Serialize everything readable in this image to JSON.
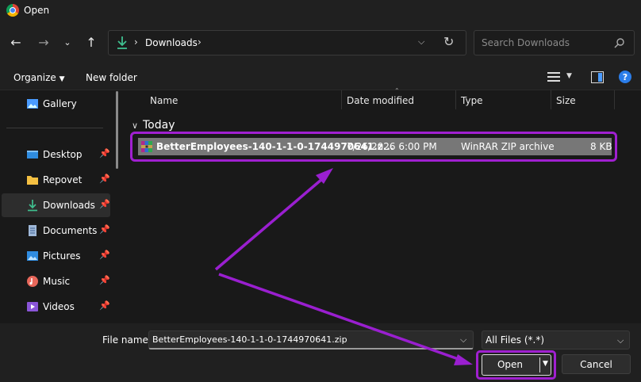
{
  "window": {
    "title": "Open"
  },
  "nav": {
    "breadcrumb_root": "Downloads",
    "search_placeholder": "Search Downloads"
  },
  "toolbar": {
    "organize_label": "Organize",
    "new_folder_label": "New folder"
  },
  "sidebar": {
    "items": [
      {
        "label": "Gallery",
        "icon": "gallery-icon"
      },
      {
        "label": "Desktop",
        "icon": "desktop-icon",
        "pinned": true
      },
      {
        "label": "Repovet",
        "icon": "folder-icon",
        "pinned": true
      },
      {
        "label": "Downloads",
        "icon": "download-icon",
        "pinned": true,
        "selected": true
      },
      {
        "label": "Documents",
        "icon": "documents-icon",
        "pinned": true
      },
      {
        "label": "Pictures",
        "icon": "pictures-icon",
        "pinned": true
      },
      {
        "label": "Music",
        "icon": "music-icon",
        "pinned": true
      },
      {
        "label": "Videos",
        "icon": "videos-icon",
        "pinned": true
      }
    ]
  },
  "columns": {
    "name": "Name",
    "date": "Date modified",
    "type": "Type",
    "size": "Size"
  },
  "group": {
    "label": "Today"
  },
  "files": [
    {
      "name": "BetterEmployees-140-1-1-0-1744970641.z...",
      "date": "7/26/2026 6:00 PM",
      "type": "WinRAR ZIP archive",
      "size": "8 KB"
    }
  ],
  "bottom": {
    "file_name_label": "File name:",
    "file_name_value": "BetterEmployees-140-1-1-0-1744970641.zip",
    "filter_value": "All Files (*.*)",
    "open_label": "Open",
    "cancel_label": "Cancel"
  },
  "colors": {
    "highlight": "#a020d0",
    "accent_green": "#3fbf8f",
    "help_blue": "#2b7de9"
  }
}
